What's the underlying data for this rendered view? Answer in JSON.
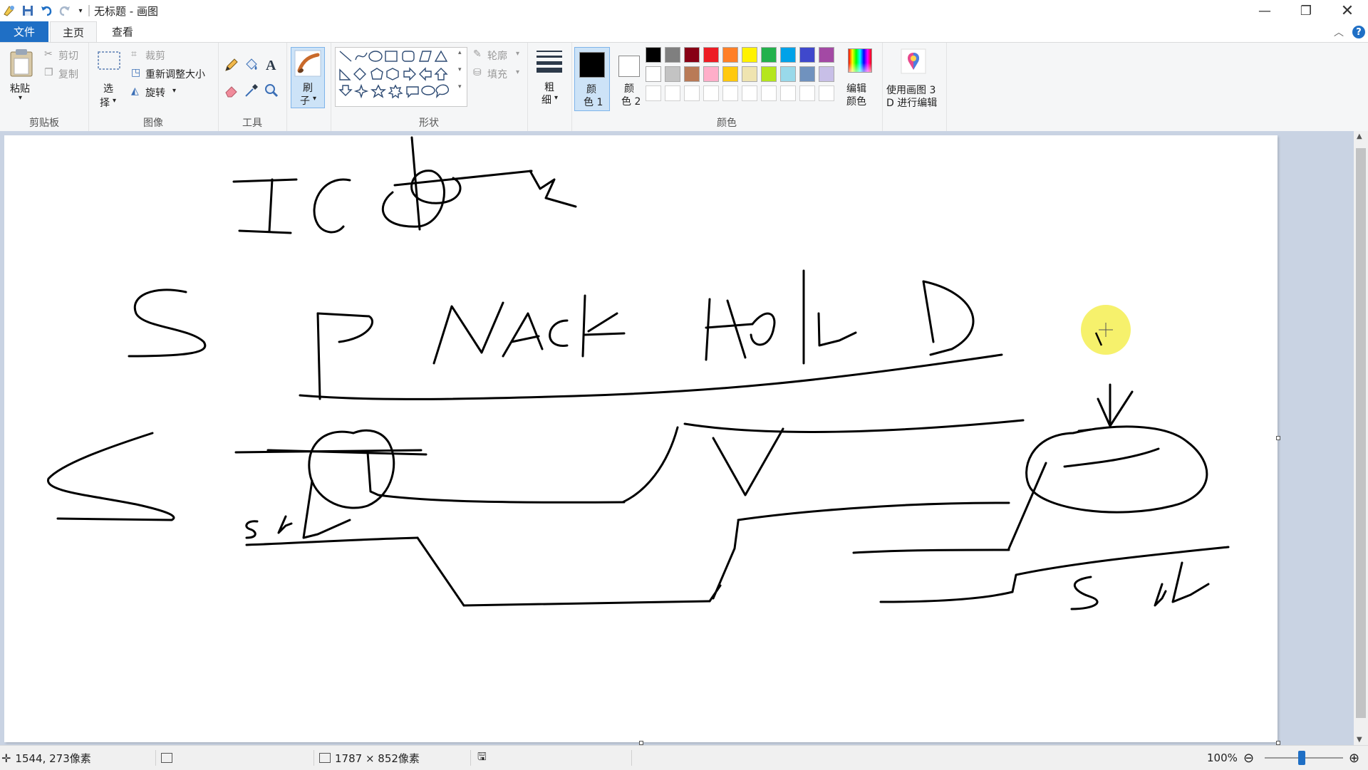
{
  "window": {
    "title": "无标题 - 画图",
    "controls": [
      "minimize",
      "maximize",
      "close"
    ]
  },
  "menu": {
    "tabs": [
      {
        "label": "文件",
        "active": false,
        "style": "file"
      },
      {
        "label": "主页",
        "active": true
      },
      {
        "label": "查看",
        "active": false
      }
    ]
  },
  "ribbon": {
    "clipboard": {
      "group_label": "剪贴板",
      "paste": "粘贴",
      "cut": "剪切",
      "copy": "复制"
    },
    "image": {
      "group_label": "图像",
      "select_top": "选",
      "select_bottom": "择",
      "crop": "裁剪",
      "resize": "重新调整大小",
      "rotate": "旋转"
    },
    "tools": {
      "group_label": "工具"
    },
    "brush": {
      "top": "刷",
      "bottom": "子"
    },
    "shapes": {
      "group_label": "形状",
      "outline": "轮廓",
      "fill": "填充"
    },
    "size": {
      "top": "粗",
      "bottom": "细"
    },
    "colors": {
      "group_label": "颜色",
      "color1_top": "颜",
      "color1_bottom": "色 1",
      "color2_top": "颜",
      "color2_bottom": "色 2",
      "edit_top": "编辑",
      "edit_bottom": "颜色",
      "color1_value": "#000000",
      "color2_value": "#ffffff",
      "palette_row1": [
        "#000000",
        "#7f7f7f",
        "#880015",
        "#ed1c24",
        "#ff7f27",
        "#fff200",
        "#22b14c",
        "#00a2e8",
        "#3f48cc",
        "#a349a4"
      ],
      "palette_row2": [
        "#ffffff",
        "#c3c3c3",
        "#b97a57",
        "#ffaec9",
        "#ffc90e",
        "#efe4b0",
        "#b5e61d",
        "#99d9ea",
        "#7092be",
        "#c8bfe7"
      ]
    },
    "paint3d": {
      "line1": "使用画图 3",
      "line2": "D 进行编辑"
    }
  },
  "status": {
    "cursor_pos": "1544, 273像素",
    "image_size": "1787 × 852像素",
    "zoom": "100%"
  },
  "drawing": {
    "texts_handwritten": [
      "IIC",
      "S",
      "P",
      "NACK",
      "HOLD",
      "S",
      "SCL",
      "SCL"
    ]
  }
}
